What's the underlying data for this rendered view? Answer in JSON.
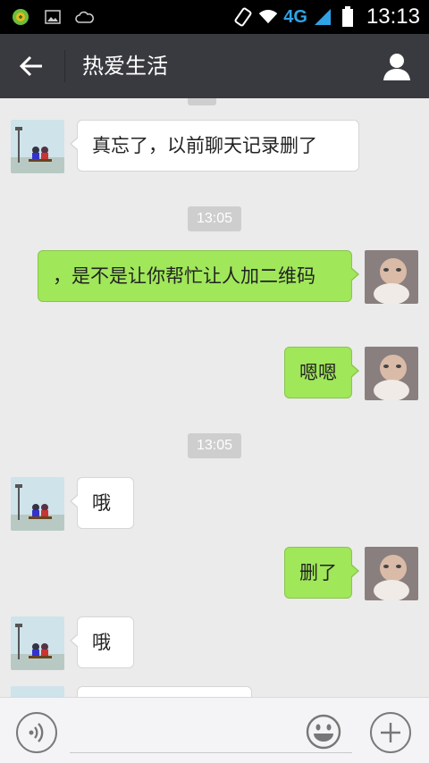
{
  "status_bar": {
    "network": "4G",
    "time": "13:13"
  },
  "header": {
    "title": "热爱生活"
  },
  "messages": [
    {
      "from": "contact",
      "text": "真忘了，以前聊天记录删了"
    },
    {
      "timestamp": "13:05"
    },
    {
      "from": "me",
      "text": "，是不是让你帮忙让人加二维码"
    },
    {
      "from": "me",
      "text": "嗯嗯"
    },
    {
      "timestamp": "13:05"
    },
    {
      "from": "contact",
      "text": "哦"
    },
    {
      "from": "me",
      "text": "删了"
    },
    {
      "from": "contact",
      "text": "哦"
    }
  ],
  "colors": {
    "header_bg": "#393a3f",
    "outgoing_bubble": "#a0e75a",
    "incoming_bubble": "#ffffff",
    "chat_bg": "#ebebeb"
  },
  "input_bar": {
    "voice_icon": "voice-icon",
    "emoji_icon": "smiley-icon",
    "more_icon": "plus-icon"
  }
}
